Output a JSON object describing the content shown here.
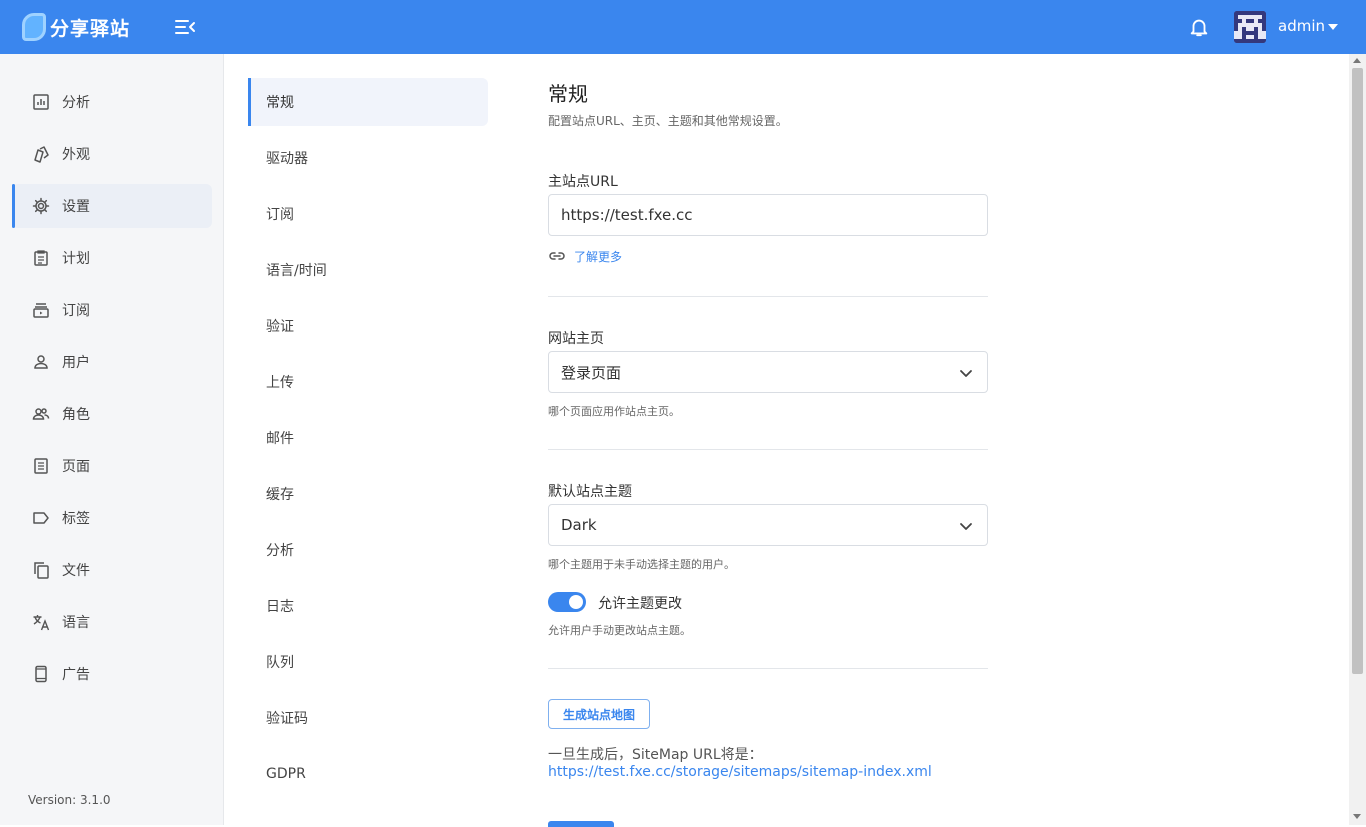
{
  "brand": {
    "name": "分享驿站",
    "accent": "#3a86ee"
  },
  "header": {
    "username": "admin"
  },
  "sidebar": {
    "items": [
      {
        "label": "分析",
        "icon": "chart-icon"
      },
      {
        "label": "外观",
        "icon": "brush-icon"
      },
      {
        "label": "设置",
        "icon": "gear-icon",
        "active": true
      },
      {
        "label": "计划",
        "icon": "clipboard-icon"
      },
      {
        "label": "订阅",
        "icon": "subscription-icon"
      },
      {
        "label": "用户",
        "icon": "user-icon"
      },
      {
        "label": "角色",
        "icon": "users-icon"
      },
      {
        "label": "页面",
        "icon": "page-icon"
      },
      {
        "label": "标签",
        "icon": "tag-icon"
      },
      {
        "label": "文件",
        "icon": "files-icon"
      },
      {
        "label": "语言",
        "icon": "translate-icon"
      },
      {
        "label": "广告",
        "icon": "phone-icon"
      }
    ],
    "version": "Version: 3.1.0"
  },
  "subnav": {
    "items": [
      "常规",
      "驱动器",
      "订阅",
      "语言/时间",
      "验证",
      "上传",
      "邮件",
      "缓存",
      "分析",
      "日志",
      "队列",
      "验证码",
      "GDPR"
    ],
    "active": "常规"
  },
  "main": {
    "title": "常规",
    "description": "配置站点URL、主页、主题和其他常规设置。",
    "site_url": {
      "label": "主站点URL",
      "value": "https://test.fxe.cc",
      "learn_more": "了解更多"
    },
    "homepage": {
      "label": "网站主页",
      "value": "登录页面",
      "help": "哪个页面应用作站点主页。"
    },
    "theme": {
      "label": "默认站点主题",
      "value": "Dark",
      "help": "哪个主题用于未手动选择主题的用户。"
    },
    "allow_theme_change": {
      "label": "允许主题更改",
      "help": "允许用户手动更改站点主题。",
      "enabled": true
    },
    "sitemap": {
      "button": "生成站点地图",
      "note": "一旦生成后，SiteMap URL将是：",
      "url": "https://test.fxe.cc/storage/sitemaps/sitemap-index.xml"
    }
  }
}
